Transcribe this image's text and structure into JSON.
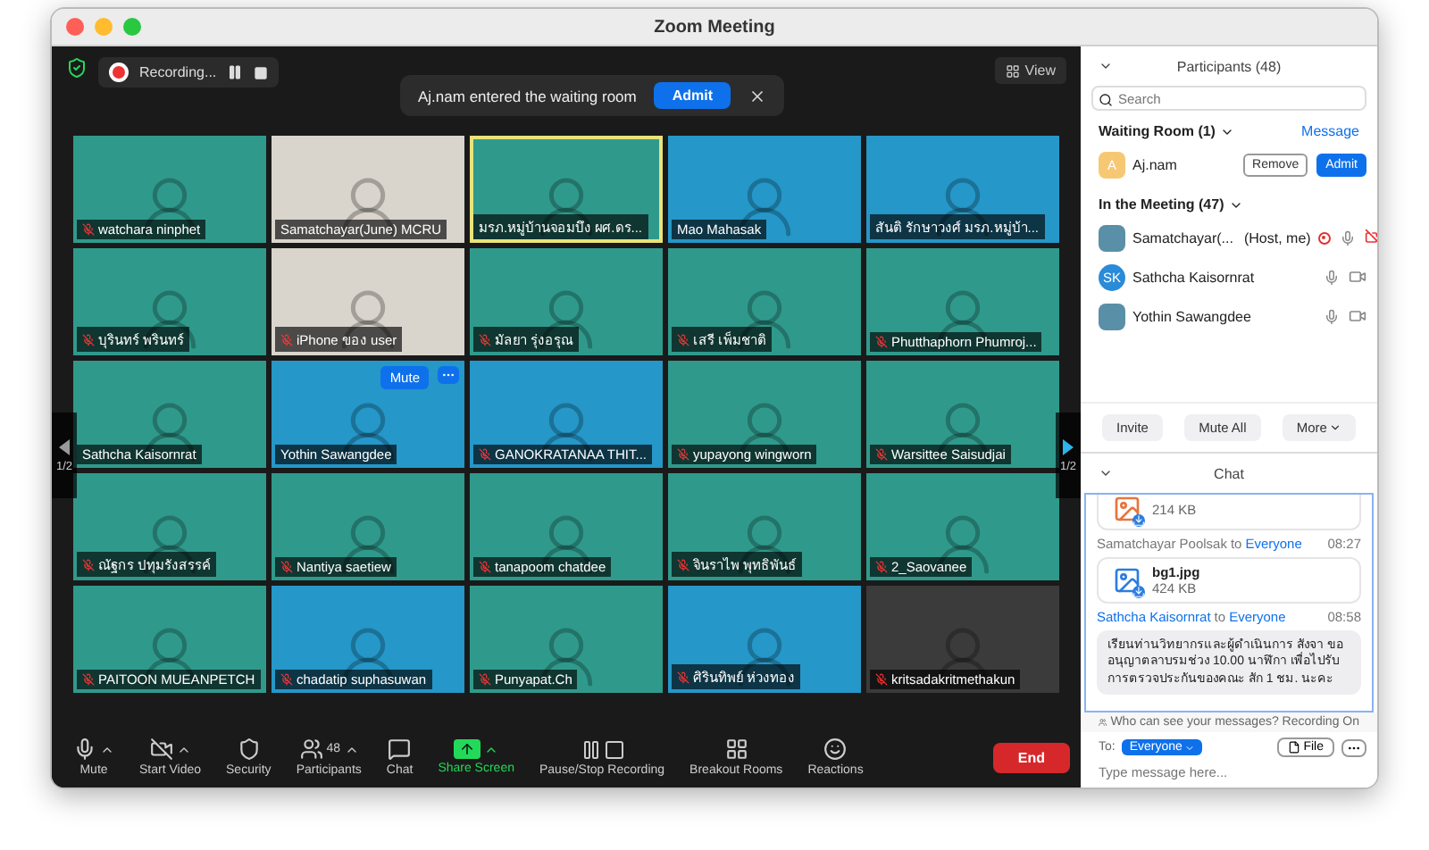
{
  "window": {
    "title": "Zoom Meeting"
  },
  "top_bar": {
    "recording_label": "Recording...",
    "notification": {
      "message": "Aj.nam entered the waiting room",
      "action": "Admit"
    },
    "view_button": "View"
  },
  "page_indicator": {
    "left": "1/2",
    "right": "1/2"
  },
  "tiles": [
    {
      "name": "watchara ninphet",
      "muted": true,
      "kind": "teal",
      "active_speaker": false
    },
    {
      "name": "Samatchayar(June) MCRU",
      "muted": false,
      "kind": "room",
      "active_speaker": false
    },
    {
      "name": "มรภ.หมู่บ้านจอมบึง ผศ.ดร...",
      "muted": false,
      "kind": "teal",
      "active_speaker": true
    },
    {
      "name": "Mao Mahasak",
      "muted": false,
      "kind": "blue",
      "active_speaker": false
    },
    {
      "name": "สันติ รักษาวงศ์ มรภ.หมู่บ้า...",
      "muted": false,
      "kind": "blue",
      "active_speaker": false
    },
    {
      "name": "บุรินทร์ พรินทร์",
      "muted": true,
      "kind": "teal",
      "active_speaker": false
    },
    {
      "name": "iPhone ของ user",
      "muted": true,
      "kind": "room",
      "active_speaker": false
    },
    {
      "name": "มัลยา รุ่งอรุณ",
      "muted": true,
      "kind": "teal",
      "active_speaker": false
    },
    {
      "name": "เสรี เพ็มชาติ",
      "muted": true,
      "kind": "teal",
      "active_speaker": false
    },
    {
      "name": "Phutthaphorn Phumroj...",
      "muted": true,
      "kind": "teal",
      "active_speaker": false
    },
    {
      "name": "Sathcha Kaisornrat",
      "muted": false,
      "kind": "teal",
      "active_speaker": false
    },
    {
      "name": "Yothin Sawangdee",
      "muted": false,
      "kind": "blue",
      "active_speaker": false,
      "mute_button": "Mute"
    },
    {
      "name": "GANOKRATANAA THIT...",
      "muted": true,
      "kind": "blue",
      "active_speaker": false
    },
    {
      "name": "yupayong wingworn",
      "muted": true,
      "kind": "teal",
      "active_speaker": false
    },
    {
      "name": "Warsittee Saisudjai",
      "muted": true,
      "kind": "teal",
      "active_speaker": false
    },
    {
      "name": "ณัฐกร ปทุมรังสรรค์",
      "muted": true,
      "kind": "teal",
      "active_speaker": false
    },
    {
      "name": "Nantiya saetiew",
      "muted": true,
      "kind": "teal",
      "active_speaker": false
    },
    {
      "name": "tanapoom chatdee",
      "muted": true,
      "kind": "teal",
      "active_speaker": false
    },
    {
      "name": "จินราไพ พุทธิพันธ์",
      "muted": true,
      "kind": "teal",
      "active_speaker": false
    },
    {
      "name": "2_Saovanee",
      "muted": true,
      "kind": "teal",
      "active_speaker": false
    },
    {
      "name": "PAITOON MUEANPETCH",
      "muted": true,
      "kind": "teal",
      "active_speaker": false
    },
    {
      "name": "chadatip suphasuwan",
      "muted": true,
      "kind": "blue",
      "active_speaker": false
    },
    {
      "name": "Punyapat.Ch",
      "muted": true,
      "kind": "teal",
      "active_speaker": false
    },
    {
      "name": "ศิรินทิพย์ ห่วงทอง",
      "muted": true,
      "kind": "blue",
      "active_speaker": false
    },
    {
      "name": "kritsadakritmethakun",
      "muted": true,
      "kind": "dark",
      "active_speaker": false
    }
  ],
  "toolbar": {
    "items": [
      {
        "label": "Mute",
        "caret": true,
        "highlighted": false
      },
      {
        "label": "Start Video",
        "caret": true,
        "highlighted": false
      },
      {
        "label": "Security",
        "caret": false,
        "highlighted": false
      },
      {
        "label": "Participants",
        "caret": true,
        "highlighted": false,
        "count": "48"
      },
      {
        "label": "Chat",
        "caret": false,
        "highlighted": false
      },
      {
        "label": "Share Screen",
        "caret": true,
        "highlighted": true
      },
      {
        "label": "Pause/Stop Recording",
        "caret": false,
        "highlighted": false
      },
      {
        "label": "Breakout Rooms",
        "caret": false,
        "highlighted": false
      },
      {
        "label": "Reactions",
        "caret": false,
        "highlighted": false
      }
    ],
    "end": "End"
  },
  "participants_panel": {
    "title": "Participants (48)",
    "search_placeholder": "Search",
    "waiting_room": {
      "title": "Waiting Room (1)",
      "message_link": "Message",
      "people": [
        {
          "initial": "A",
          "name": "Aj.nam",
          "remove": "Remove",
          "admit": "Admit"
        }
      ]
    },
    "in_meeting": {
      "title": "In the Meeting (47)",
      "people": [
        {
          "name": "Samatchayar(...",
          "role": "(Host, me)",
          "recording": true,
          "video_off": true
        },
        {
          "name": "Sathcha Kaisornrat",
          "initials": "SK",
          "recording": false,
          "video_off": false
        },
        {
          "name": "Yothin Sawangdee",
          "recording": false,
          "video_off": false
        }
      ]
    },
    "buttons": [
      "Invite",
      "Mute All",
      "More"
    ]
  },
  "chat": {
    "title": "Chat",
    "messages": [
      {
        "kind": "file",
        "size": "214 KB"
      },
      {
        "kind": "header",
        "sender": "Samatchayar Poolsak",
        "highlight_sender": false,
        "to_word": "to",
        "recipient": "Everyone",
        "time": "08:27"
      },
      {
        "kind": "file",
        "filename": "bg1.jpg",
        "size": "424 KB"
      },
      {
        "kind": "header",
        "sender": "Sathcha Kaisornrat",
        "highlight_sender": true,
        "to_word": "to",
        "recipient": "Everyone",
        "time": "08:58"
      },
      {
        "kind": "text",
        "text": "เรียนท่านวิทยากรและผู้ดำเนินการ สังจา ขออนุญาตลาบรมช่วง 10.00 นาฬิกา เพื่อไปรับการตรวจประกันของคณะ สัก 1 ชม. นะคะ"
      }
    ],
    "privacy_note": "Who can see your messages? Recording On",
    "to_label": "To:",
    "recipient": "Everyone",
    "file_button": "File",
    "placeholder": "Type message here..."
  }
}
